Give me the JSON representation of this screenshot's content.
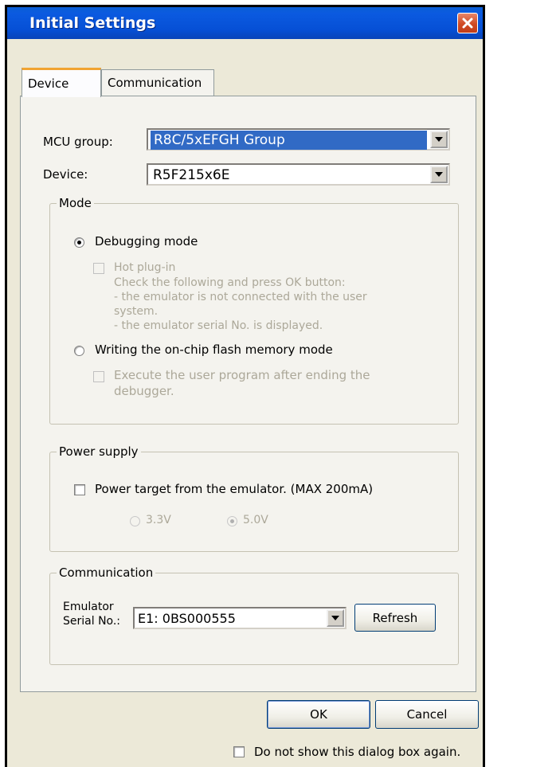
{
  "window": {
    "title": "Initial Settings"
  },
  "tabs": [
    {
      "label": "Device"
    },
    {
      "label": "Communication"
    }
  ],
  "device": {
    "mcu_group_label": "MCU group:",
    "mcu_group_value": "R8C/5xEFGH Group",
    "device_label": "Device:",
    "device_value": "R5F215x6E"
  },
  "mode": {
    "title": "Mode",
    "debugging_label": "Debugging mode",
    "hot_plugin_label": "Hot plug-in",
    "hot_plugin_note": [
      "Check the following and press OK button:",
      "- the emulator is not connected with the user",
      "system.",
      "- the emulator serial No. is displayed."
    ],
    "flash_label": "Writing the on-chip flash memory mode",
    "execute_label_1": "Execute the user program after ending the",
    "execute_label_2": "debugger."
  },
  "power": {
    "title": "Power supply",
    "power_target_label": "Power target from the emulator. (MAX 200mA)",
    "v33": "3.3V",
    "v50": "5.0V"
  },
  "communication": {
    "title": "Communication",
    "emulator_label_1": "Emulator",
    "emulator_label_2": "Serial No.:",
    "serial_value": "E1: 0BS000555",
    "refresh_label": "Refresh"
  },
  "footer": {
    "ok_label": "OK",
    "cancel_label": "Cancel",
    "dont_show_label": "Do not show this dialog box again."
  },
  "colors": {
    "title_bar": "#0a5fd6",
    "selection": "#316ac5",
    "dialog_bg": "#ece9d8"
  }
}
